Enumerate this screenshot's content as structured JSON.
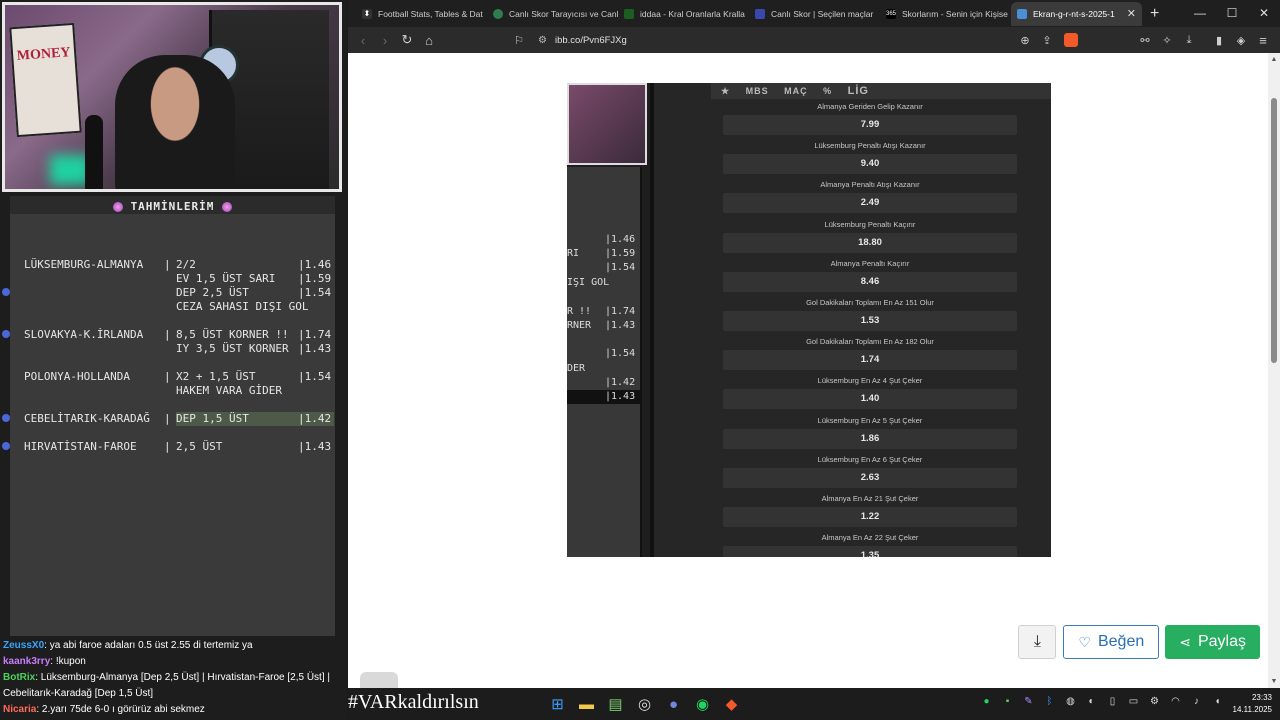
{
  "overlay": {
    "panel_title": "TAHMİNLERİM",
    "bets": [
      {
        "match": "LÜKSEMBURG-ALMANYA",
        "picks": [
          "2/2",
          "EV 1,5 ÜST SARI",
          "DEP 2,5 ÜST",
          "CEZA SAHASI DIŞI GOL"
        ],
        "odds": [
          "|1.46",
          "|1.59",
          "|1.54",
          ""
        ]
      },
      {
        "match": "SLOVAKYA-K.İRLANDA",
        "picks": [
          "8,5 ÜST KORNER !!",
          "IY 3,5 ÜST KORNER"
        ],
        "odds": [
          "|1.74",
          "|1.43"
        ]
      },
      {
        "match": "POLONYA-HOLLANDA",
        "picks": [
          "X2 + 1,5 ÜST",
          "HAKEM VARA GİDER"
        ],
        "odds": [
          "|1.54",
          ""
        ]
      },
      {
        "match": "CEBELİTARIK-KARADAĞ",
        "picks": [
          "DEP 1,5 ÜST"
        ],
        "odds": [
          "|1.42"
        ]
      },
      {
        "match": "HIRVATİSTAN-FAROE",
        "picks": [
          "2,5 ÜST"
        ],
        "odds": [
          "|1.43"
        ]
      }
    ],
    "separator": "|"
  },
  "chat": [
    {
      "user": "ZeussX0",
      "msg": ": ya abi faroe adaları 0.5 üst 2.55 di tertemiz ya"
    },
    {
      "user": "kaank3rry",
      "msg": ": !kupon"
    },
    {
      "user": "BotRix",
      "msg": ": Lüksemburg-Almanya [Dep 2,5 Üst] | Hırvatistan-Faroe [2,5 Üst] |"
    },
    {
      "user": "",
      "msg": "Cebelitarık-Karadağ [Dep 1,5 Üst]"
    },
    {
      "user": "Nicaria",
      "msg": ": 2.yarı 75de 6-0 ı görürüz abi sekmez"
    }
  ],
  "browser": {
    "tabs": [
      {
        "label": "Football Stats, Tables & Dat",
        "active": false
      },
      {
        "label": "Canlı Skor Tarayıcısı ve Canlı",
        "active": false
      },
      {
        "label": "iddaa - Kral Oranlarla Kralla",
        "active": false
      },
      {
        "label": "Canlı Skor | Seçilen maçlar",
        "active": false
      },
      {
        "label": "Skorlarım - Senin için Kişise",
        "active": false
      },
      {
        "label": "Ekran-g-r-nt-s-2025-1",
        "active": true
      }
    ],
    "url": "ibb.co/Pvn6FJXg",
    "icons": {
      "back": "arrow-left-icon",
      "forward": "arrow-right-icon",
      "reload": "reload-icon",
      "home": "home-icon"
    }
  },
  "screenshot": {
    "mini_odds": [
      "|1.46",
      "|1.59",
      "|1.54",
      "|1.74",
      "|1.43",
      "|1.54",
      "|1.42",
      "|1.43"
    ],
    "mini_text": [
      "RI",
      "IŞI GOL",
      "R !!",
      "RNER",
      "DER"
    ],
    "header": [
      "MBS",
      "MAÇ",
      "%",
      "LİG"
    ],
    "markets": [
      {
        "name": "Almanya Geriden Gelip Kazanır",
        "odd": "7.99"
      },
      {
        "name": "Lüksemburg Penaltı Atışı Kazanır",
        "odd": "9.40"
      },
      {
        "name": "Almanya Penaltı Atışı Kazanır",
        "odd": "2.49"
      },
      {
        "name": "Lüksemburg Penaltı Kaçırır",
        "odd": "18.80"
      },
      {
        "name": "Almanya Penaltı Kaçırır",
        "odd": "8.46"
      },
      {
        "name": "Gol Dakikaları Toplamı En Az 151 Olur",
        "odd": "1.53"
      },
      {
        "name": "Gol Dakikaları Toplamı En Az 182 Olur",
        "odd": "1.74"
      },
      {
        "name": "Lüksemburg En Az 4 Şut Çeker",
        "odd": "1.40"
      },
      {
        "name": "Lüksemburg En Az 5 Şut Çeker",
        "odd": "1.86"
      },
      {
        "name": "Lüksemburg En Az 6 Şut Çeker",
        "odd": "2.63"
      },
      {
        "name": "Almanya En Az 21 Şut Çeker",
        "odd": "1.22"
      },
      {
        "name": "Almanya En Az 22 Şut Çeker",
        "odd": "1.35"
      }
    ]
  },
  "actions": {
    "like": "Beğen",
    "share": "Paylaş"
  },
  "taskbar": {
    "hashtag": "#VARkaldırılsın",
    "time": "23:33",
    "date": "14.11.2025"
  }
}
